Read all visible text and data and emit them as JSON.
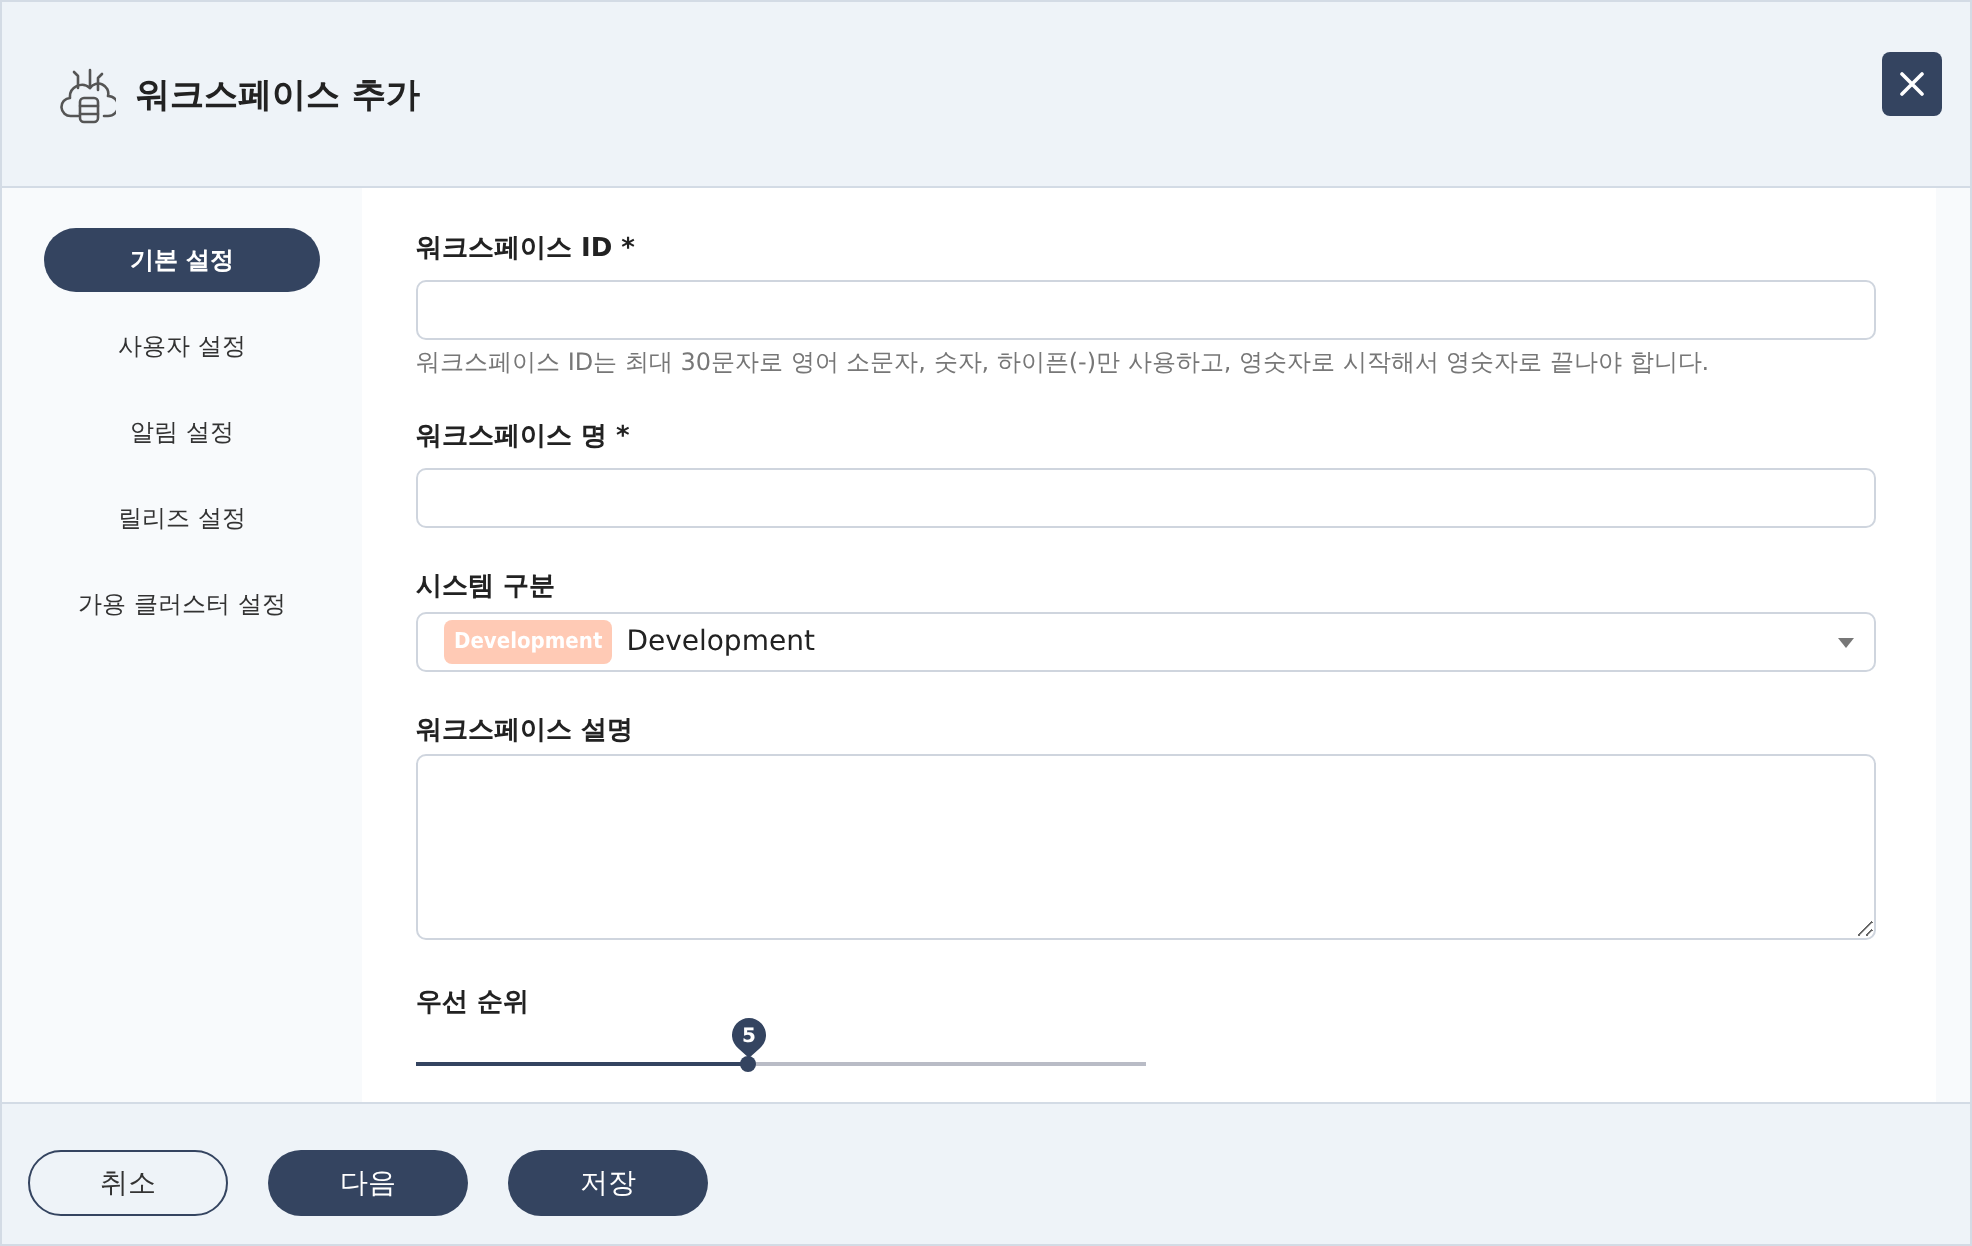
{
  "dialog": {
    "title": "워크스페이스 추가"
  },
  "sidebar": {
    "items": [
      {
        "label": "기본 설정",
        "selected": true
      },
      {
        "label": "사용자 설정",
        "selected": false
      },
      {
        "label": "알림 설정",
        "selected": false
      },
      {
        "label": "릴리즈 설정",
        "selected": false
      },
      {
        "label": "가용 클러스터 설정",
        "selected": false
      }
    ]
  },
  "form": {
    "fields": [
      {
        "kind": "text",
        "label": "워크스페이스 ID *",
        "hint": "워크스페이스 ID는 최대 30문자로 영어 소문자, 숫자, 하이픈(-)만 사용하고, 영숫자로 시작해서 영숫자로 끝나야 합니다."
      },
      {
        "kind": "text",
        "label": "워크스페이스 명 *"
      },
      {
        "kind": "select",
        "label": "시스템 구분",
        "tag": {
          "label": "Development",
          "color": "#ffcab5"
        },
        "value": "Development"
      },
      {
        "kind": "textarea",
        "label": "워크스페이스 설명"
      },
      {
        "kind": "slider",
        "label": "우선 순위",
        "level": 0.455,
        "value_label": "5"
      }
    ]
  },
  "footer": {
    "buttons": [
      {
        "label": "취소",
        "kind": "outline"
      },
      {
        "label": "다음",
        "kind": "primary"
      },
      {
        "label": "저장",
        "kind": "primary"
      }
    ]
  }
}
